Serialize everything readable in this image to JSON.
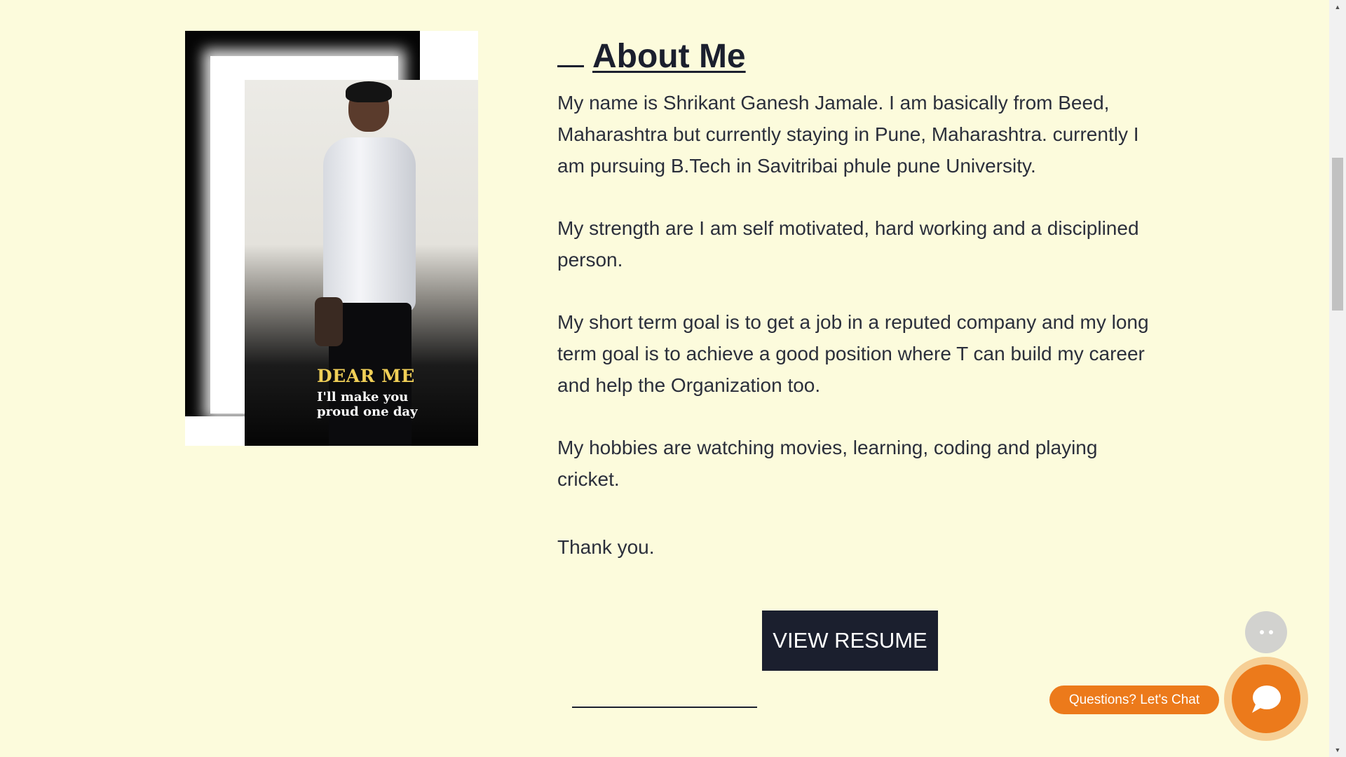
{
  "about": {
    "heading": "About Me",
    "paragraphs": [
      "My name is Shrikant Ganesh Jamale. I am basically from Beed, Maharashtra but currently staying in Pune, Maharashtra. currently I am pursuing B.Tech in Savitribai phule pune University.",
      "My strength are I am self motivated, hard working and a disciplined person.",
      "My short term goal is to get a job in a reputed company and my long term goal is to achieve a good position where T can build my career and help the Organization too.",
      "My hobbies are watching movies, learning, coding and playing cricket."
    ],
    "thanks": "Thank you.",
    "resume_button": "VIEW RESUME"
  },
  "photo": {
    "caption_title": "DEAR ME",
    "caption_sub": "I'll make you proud one day"
  },
  "chat": {
    "label": "Questions? Let's Chat"
  },
  "colors": {
    "background": "#fcfbdc",
    "heading": "#1b1f2e",
    "accent": "#ec7a1b",
    "caption": "#f0cf57"
  },
  "icons": [
    "more-options-icon",
    "chat-bubble-icon",
    "scroll-up-icon",
    "scroll-down-icon"
  ]
}
